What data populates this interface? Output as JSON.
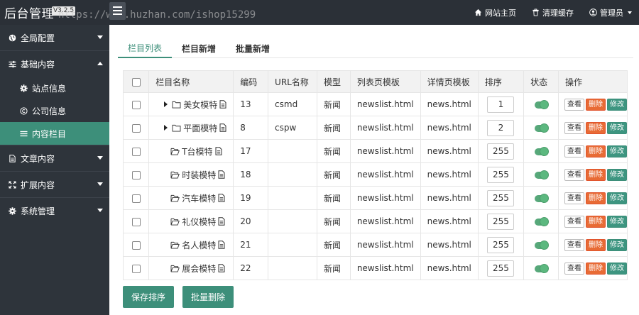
{
  "header": {
    "title": "后台管理",
    "version": "V3.2.5",
    "watermark": "https://www.huzhan.com/ishop15299",
    "links": [
      {
        "label": "网站主页",
        "icon": "home-icon"
      },
      {
        "label": "清理缓存",
        "icon": "trash-icon"
      },
      {
        "label": "管理员",
        "icon": "user-icon"
      }
    ]
  },
  "sidebar": {
    "items": [
      {
        "label": "全局配置",
        "icon": "globe-icon"
      },
      {
        "label": "基础内容",
        "icon": "sliders-icon"
      },
      {
        "label": "站点信息",
        "icon": "gear-icon"
      },
      {
        "label": "公司信息",
        "icon": "copyright-icon"
      },
      {
        "label": "内容栏目",
        "icon": "list-icon"
      },
      {
        "label": "文章内容",
        "icon": "file-icon"
      },
      {
        "label": "扩展内容",
        "icon": "expand-icon"
      },
      {
        "label": "系统管理",
        "icon": "gear-icon"
      }
    ]
  },
  "tabs": [
    "栏目列表",
    "栏目新增",
    "批量新增"
  ],
  "table": {
    "headers": [
      "栏目名称",
      "编码",
      "URL名称",
      "模型",
      "列表页模板",
      "详情页模板",
      "排序",
      "状态",
      "操作"
    ],
    "rows": [
      {
        "name": "美女模特",
        "code": "13",
        "url": "csmd",
        "model": "新闻",
        "list_tpl": "newslist.html",
        "detail_tpl": "news.html",
        "sort": "1"
      },
      {
        "name": "平面模特",
        "code": "8",
        "url": "cspw",
        "model": "新闻",
        "list_tpl": "newslist.html",
        "detail_tpl": "news.html",
        "sort": "2"
      },
      {
        "name": "T台模特",
        "code": "17",
        "url": "",
        "model": "新闻",
        "list_tpl": "newslist.html",
        "detail_tpl": "news.html",
        "sort": "255"
      },
      {
        "name": "时装模特",
        "code": "18",
        "url": "",
        "model": "新闻",
        "list_tpl": "newslist.html",
        "detail_tpl": "news.html",
        "sort": "255"
      },
      {
        "name": "汽车模特",
        "code": "19",
        "url": "",
        "model": "新闻",
        "list_tpl": "newslist.html",
        "detail_tpl": "news.html",
        "sort": "255"
      },
      {
        "name": "礼仪模特",
        "code": "20",
        "url": "",
        "model": "新闻",
        "list_tpl": "newslist.html",
        "detail_tpl": "news.html",
        "sort": "255"
      },
      {
        "name": "名人模特",
        "code": "21",
        "url": "",
        "model": "新闻",
        "list_tpl": "newslist.html",
        "detail_tpl": "news.html",
        "sort": "255"
      },
      {
        "name": "展会模特",
        "code": "22",
        "url": "",
        "model": "新闻",
        "list_tpl": "newslist.html",
        "detail_tpl": "news.html",
        "sort": "255"
      }
    ],
    "actions": {
      "view": "查看",
      "delete": "删除",
      "edit": "修改"
    }
  },
  "buttons": {
    "save_sort": "保存排序",
    "batch_delete": "批量删除"
  },
  "colors": {
    "accent": "#3d8f7a",
    "sidebar_bg": "#2e343b",
    "topbar_bg": "#2b3037",
    "delete": "#e86b35",
    "toggle_on": "#5cb87f"
  }
}
